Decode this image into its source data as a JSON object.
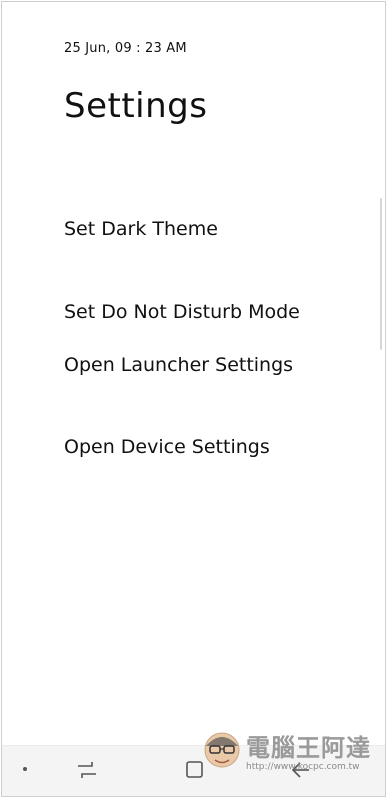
{
  "status": {
    "datetime": "25 Jun, 09 : 23 AM"
  },
  "page": {
    "title": "Settings"
  },
  "settings": [
    {
      "label": "Set Dark Theme"
    },
    {
      "label": "Set Do Not Disturb Mode"
    },
    {
      "label": "Open Launcher Settings"
    },
    {
      "label": "Open Device Settings"
    }
  ],
  "nav": {
    "icons": [
      "dot-indicator",
      "recents-icon",
      "home-icon",
      "back-icon"
    ]
  },
  "watermark": {
    "title": "電腦王阿達",
    "url": "http://www.kocpc.com.tw"
  },
  "colors": {
    "background": "#ffffff",
    "text": "#111111",
    "nav_bar": "#f4f4f4"
  }
}
